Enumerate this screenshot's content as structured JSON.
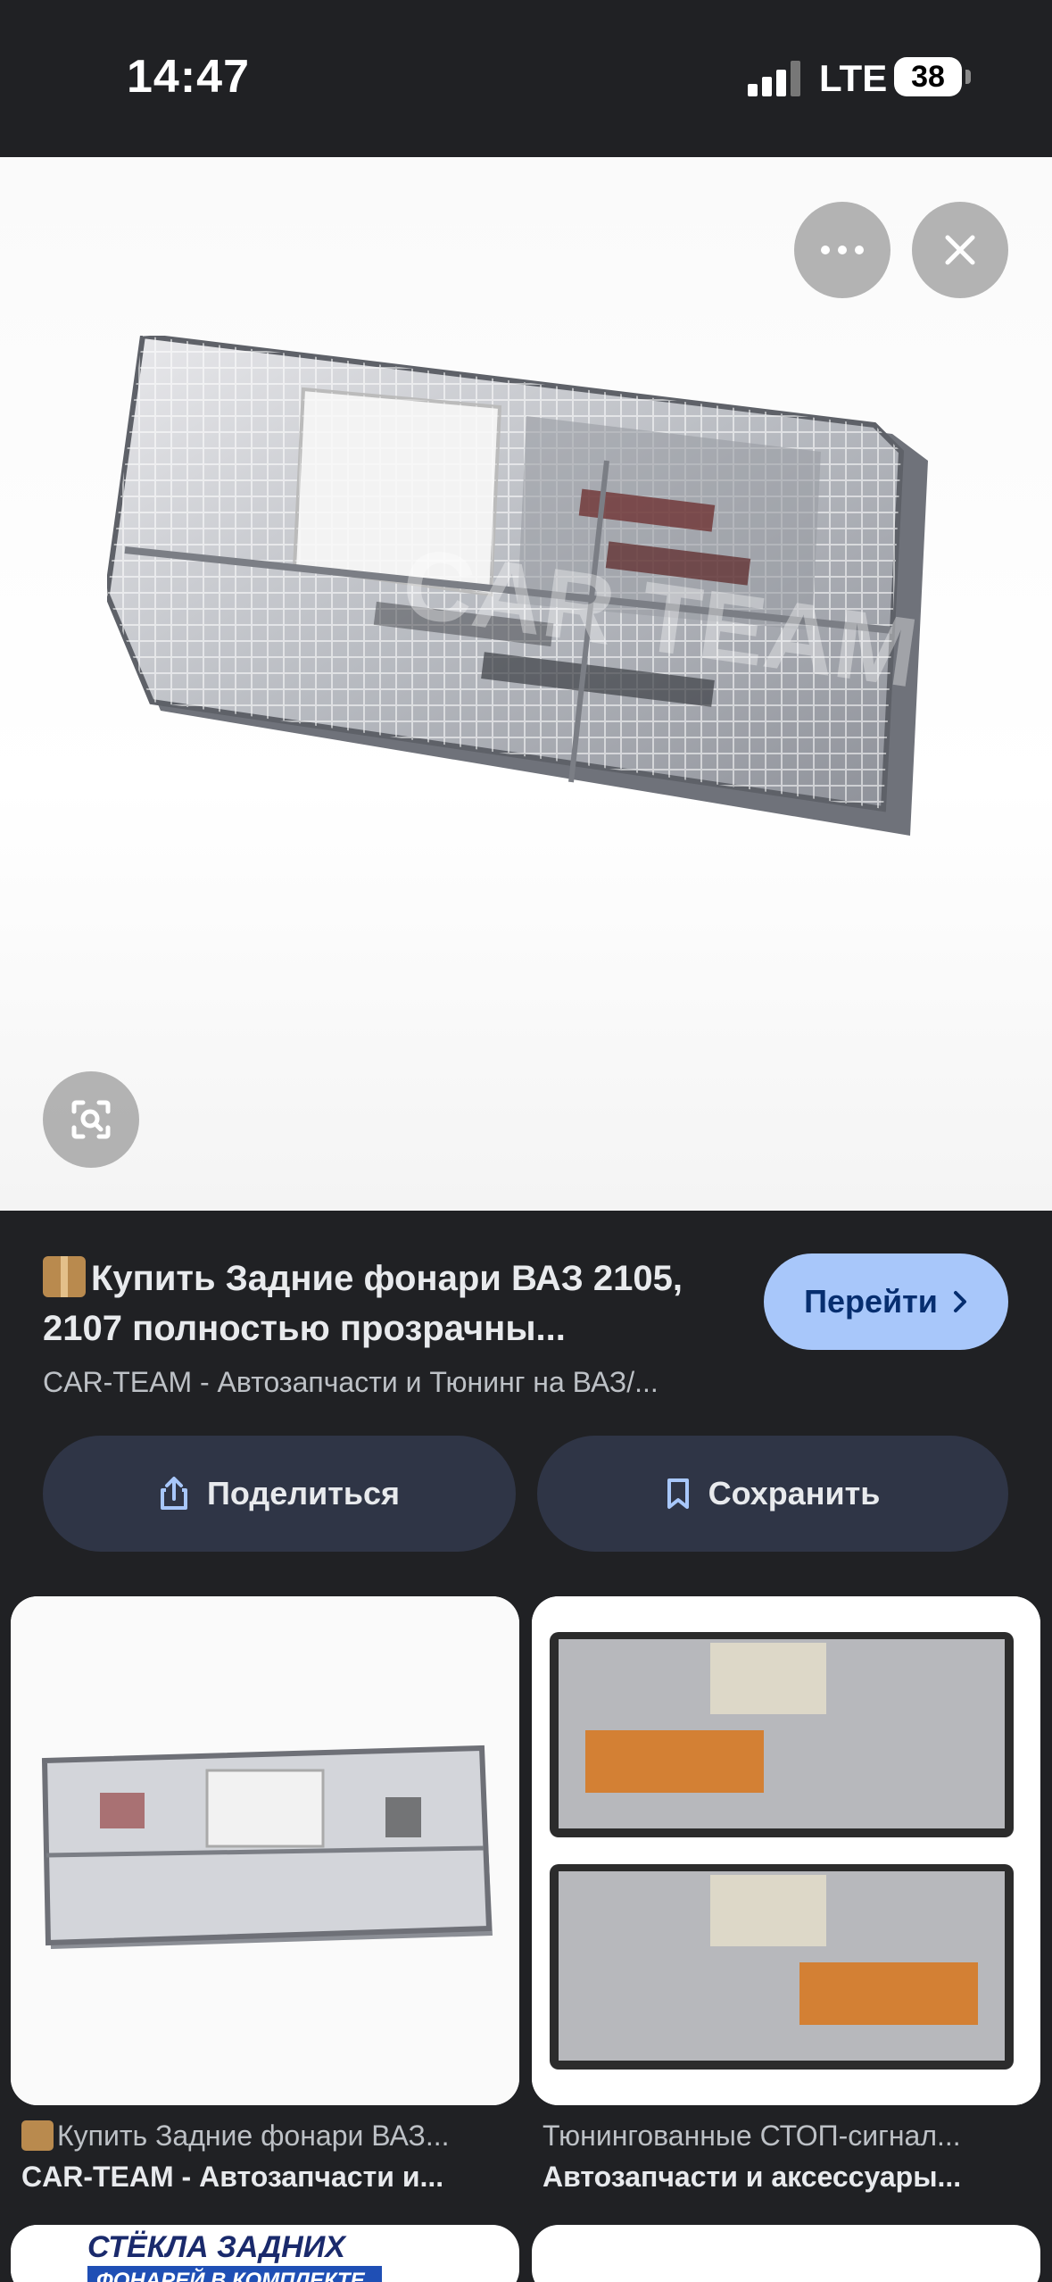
{
  "status_bar": {
    "time": "14:47",
    "network": "LTE",
    "battery": "38"
  },
  "viewer": {
    "more_icon": "ellipsis-icon",
    "close_icon": "close-icon",
    "lens_icon": "lens-icon",
    "watermark": "CAR TEAM"
  },
  "result": {
    "title": "Купить Задние фонари ВАЗ 2105, 2107 полностью прозрачны...",
    "source": "CAR-TEAM - Автозапчасти и Тюнинг на ВАЗ/...",
    "go_label": "Перейти",
    "share_label": "Поделиться",
    "save_label": "Сохранить"
  },
  "related": [
    {
      "title": "Купить Задние фонари ВАЗ...",
      "source": "CAR-TEAM - Автозапчасти и..."
    },
    {
      "title": "Тюнингованные СТОП-сигнал...",
      "source": "Автозапчасти и аксессуары..."
    },
    {
      "banner_line1": "СТЁКЛА ЗАДНИХ",
      "banner_line2": "ФОНАРЕЙ В КОМПЛЕКТЕ"
    }
  ],
  "colors": {
    "background": "#202124",
    "go_button": "#a8c7fa",
    "action_button": "#2f3546"
  }
}
